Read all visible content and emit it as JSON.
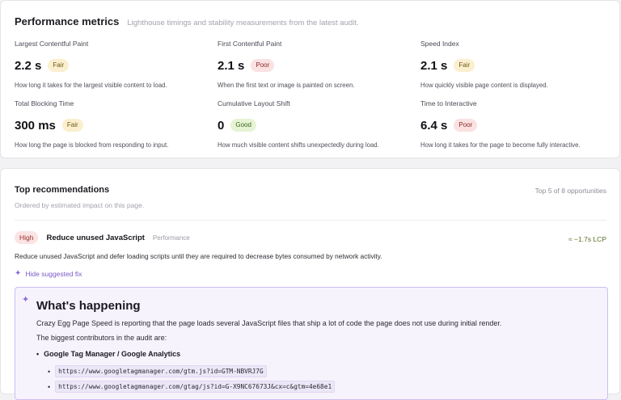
{
  "performance": {
    "title": "Performance metrics",
    "subtitle": "Lighthouse timings and stability measurements from the latest audit.",
    "metrics": [
      {
        "label": "Largest Contentful Paint",
        "value": "2.2 s",
        "status": "Fair",
        "description": "How long it takes for the largest visible content to load."
      },
      {
        "label": "First Contentful Paint",
        "value": "2.1 s",
        "status": "Poor",
        "description": "When the first text or image is painted on screen."
      },
      {
        "label": "Speed Index",
        "value": "2.1 s",
        "status": "Fair",
        "description": "How quickly visible page content is displayed."
      },
      {
        "label": "Total Blocking Time",
        "value": "300 ms",
        "status": "Fair",
        "description": "How long the page is blocked from responding to input."
      },
      {
        "label": "Cumulative Layout Shift",
        "value": "0",
        "status": "Good",
        "description": "How much visible content shifts unexpectedly during load."
      },
      {
        "label": "Time to Interactive",
        "value": "6.4 s",
        "status": "Poor",
        "description": "How long it takes for the page to become fully interactive."
      }
    ]
  },
  "recommendations": {
    "title": "Top recommendations",
    "subtitle": "Ordered by estimated impact on this page.",
    "count_text": "Top 5 of 8 opportunities",
    "item": {
      "priority": "High",
      "title": "Reduce unused JavaScript",
      "category": "Performance",
      "impact": "≈ −1.7s LCP",
      "description": "Reduce unused JavaScript and defer loading scripts until they are required to decrease bytes consumed by network activity.",
      "toggle_label": "Hide suggested fix",
      "toggle_icon": "sparkle-icon",
      "fix": {
        "heading": "What's happening",
        "paragraph1": "Crazy Egg Page Speed is reporting that the page loads several JavaScript files that ship a lot of code the page does not use during initial render.",
        "paragraph2": "The biggest contributors in the audit are:",
        "contributor": "Google Tag Manager / Google Analytics",
        "urls": [
          "https://www.googletagmanager.com/gtm.js?id=GTM-NBVRJ7G",
          "https://www.googletagmanager.com/gtag/js?id=G-X9NC67673J&cx=c&gtm=4e68e1"
        ]
      }
    }
  },
  "colors": {
    "fair_bg": "#fbefcf",
    "poor_bg": "#fbe1e1",
    "good_bg": "#e6f3d4",
    "accent": "#7a5bc7",
    "impact": "#58701f"
  }
}
